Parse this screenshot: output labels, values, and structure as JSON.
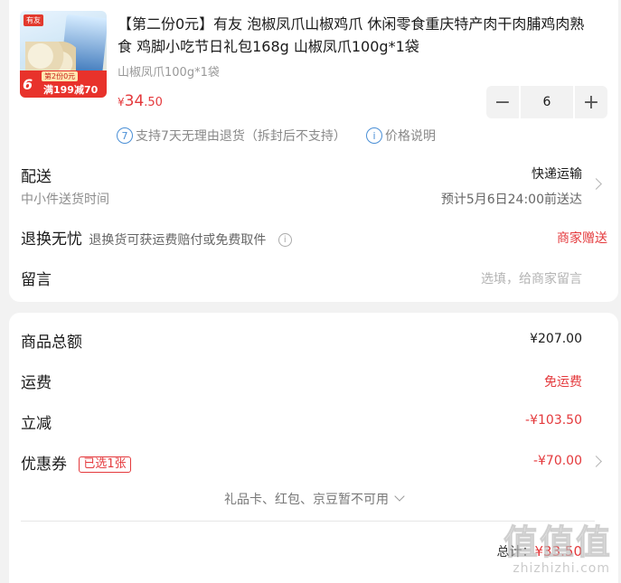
{
  "product": {
    "thumb": {
      "brand": "有友",
      "promo_top": "第2份0元",
      "promo_main": "满199减70",
      "promo_num": "6"
    },
    "title": "【第二份0元】有友 泡椒凤爪山椒鸡爪 休闲零食重庆特产肉干肉脯鸡肉熟食 鸡脚小吃节日礼包168g 山椒凤爪100g*1袋",
    "variant": "山椒凤爪100g*1袋",
    "price": {
      "symbol": "¥",
      "integer": "34",
      "decimal": ".50"
    },
    "quantity": "6",
    "minus_label": "−",
    "plus_label": "+"
  },
  "services": {
    "return_policy": "支持7天无理由退货（拆封后不支持）",
    "return_icon_text": "7",
    "price_note": "价格说明",
    "price_icon_text": "i"
  },
  "delivery": {
    "label": "配送",
    "sub": "中小件送货时间",
    "method": "快递运输",
    "eta": "预计5月6日24:00前送达"
  },
  "returns": {
    "label": "退换无忧",
    "desc": "退换货可获运费赔付或免费取件",
    "info_icon_text": "i",
    "badge": "商家赠送"
  },
  "message": {
    "label": "留言",
    "placeholder": "选填，给商家留言"
  },
  "summary": {
    "goods_label": "商品总额",
    "goods_value": "¥207.00",
    "shipping_label": "运费",
    "shipping_value": "免运费",
    "discount_label": "立减",
    "discount_value": "-¥103.50",
    "coupon_label": "优惠券",
    "coupon_tag": "已选1张",
    "coupon_value": "-¥70.00",
    "gift_note": "礼品卡、红包、京豆暂不可用",
    "total_label": "总计：",
    "total_value": "¥33.50"
  },
  "watermark": {
    "big": "值值值",
    "small": "zhizhizhi.com"
  },
  "colors": {
    "accent_red": "#e4393c",
    "info_blue": "#4a8fd6",
    "background": "#f2f2f2"
  }
}
